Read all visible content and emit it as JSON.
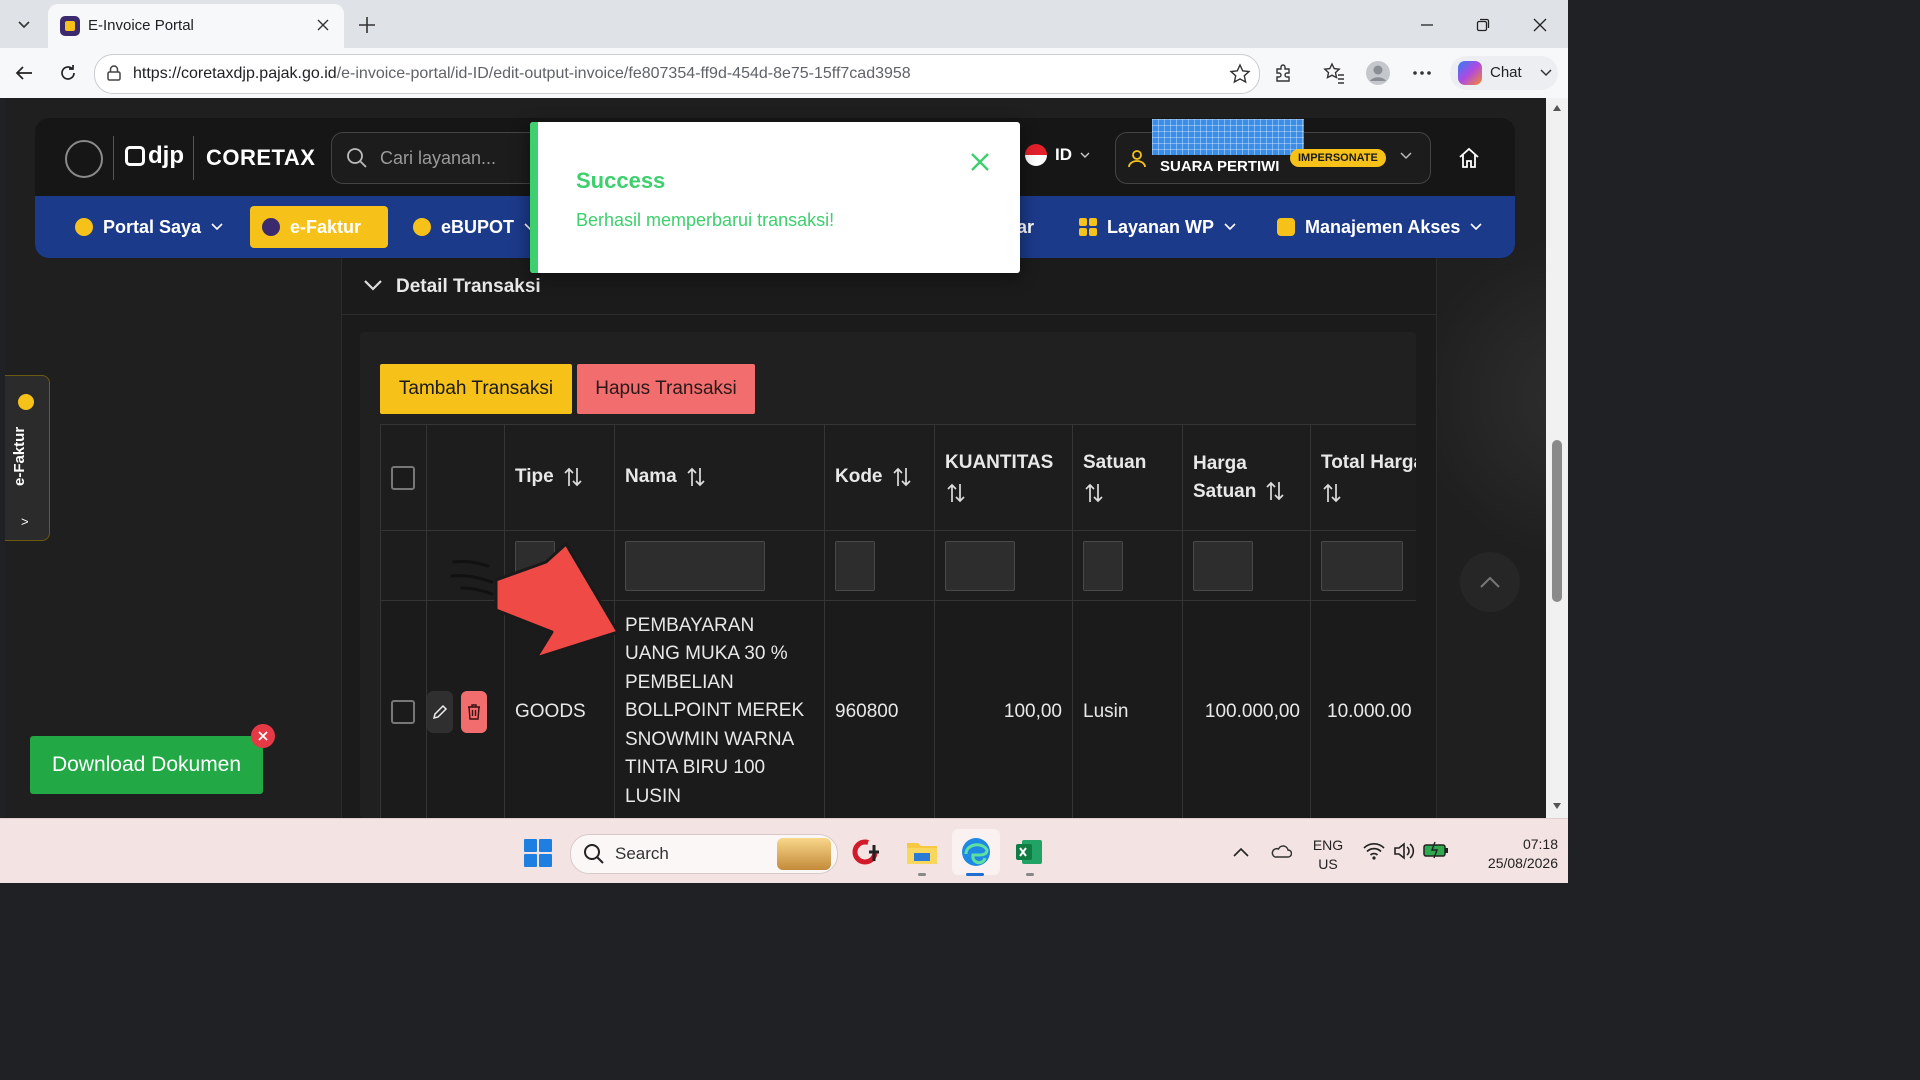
{
  "browser": {
    "tab_title": "E-Invoice Portal",
    "url_host": "https://coretaxdjp.pajak.go.id",
    "url_path": "/e-invoice-portal/id-ID/edit-output-invoice/fe807354-ff9d-454d-8e75-15ff7cad3958",
    "chat_label": "Chat"
  },
  "header": {
    "djp_logo": "djp",
    "coretax_logo": "CORETAX",
    "search_placeholder": "Cari layanan...",
    "language": "ID",
    "user_name": "SUARA PERTIWI",
    "impersonate_badge": "IMPERSONATE"
  },
  "nav": {
    "items": [
      {
        "label": "Portal Saya"
      },
      {
        "label": "e-Faktur"
      },
      {
        "label": "eBUPOT"
      },
      {
        "label": "ar"
      },
      {
        "label": "Layanan WP"
      },
      {
        "label": "Manajemen Akses"
      }
    ]
  },
  "side_tab": {
    "label": "e-Faktur",
    "arrow": ">"
  },
  "section": {
    "title": "Detail Transaksi"
  },
  "buttons": {
    "add": "Tambah Transaksi",
    "delete": "Hapus Transaksi",
    "download": "Download Dokumen"
  },
  "table": {
    "headers": {
      "tipe": "Tipe",
      "nama": "Nama",
      "kode": "Kode",
      "kuantitas": "KUANTITAS",
      "satuan": "Satuan",
      "harga_satuan": "Harga Satuan",
      "total_harga": "Total Harga"
    },
    "rows": [
      {
        "tipe": "GOODS",
        "nama": "PEMBAYARAN UANG MUKA 30 % PEMBELIAN BOLLPOINT MEREK SNOWMIN WARNA TINTA BIRU 100 LUSIN",
        "kode": "960800",
        "kuantitas": "100,00",
        "satuan": "Lusin",
        "harga_satuan": "100.000,00",
        "total_harga": "10.000.00"
      }
    ]
  },
  "toast": {
    "title": "Success",
    "message": "Berhasil memperbarui transaksi!"
  },
  "taskbar": {
    "search_label": "Search",
    "lang_top": "ENG",
    "lang_bottom": "US",
    "time": "07:18",
    "date": "25/08/2026"
  },
  "colors": {
    "accent_yellow": "#f6c21a",
    "nav_blue": "#1c3a8a",
    "success_green": "#3ecf6e",
    "danger_red": "#f26d6d",
    "download_green": "#22a845"
  }
}
